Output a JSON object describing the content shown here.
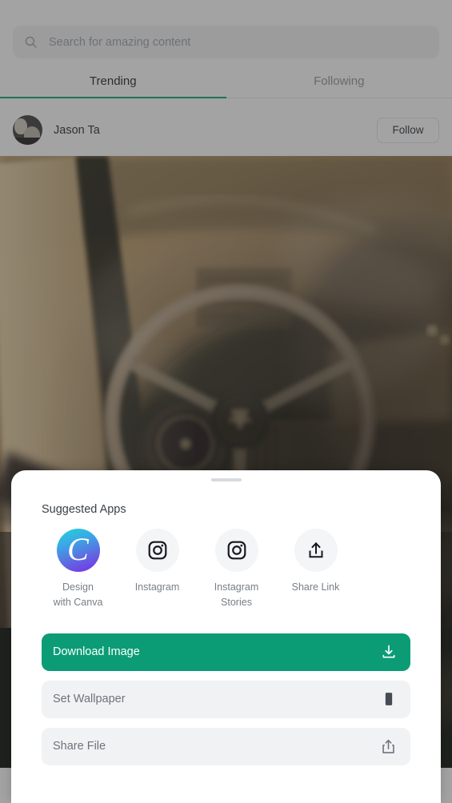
{
  "search": {
    "placeholder": "Search for amazing content",
    "value": "",
    "icon": "search-icon"
  },
  "tabs": [
    {
      "label": "Trending",
      "active": true
    },
    {
      "label": "Following",
      "active": false
    }
  ],
  "post": {
    "author": "Jason Ta",
    "follow_label": "Follow",
    "avatar_icon": "avatar",
    "image_alt": "vintage car interior steering wheel"
  },
  "sheet": {
    "handle": "drag-handle",
    "title": "Suggested Apps",
    "apps": [
      {
        "label": "Design\nwith Canva",
        "label_line1": "Design",
        "label_line2": "with Canva",
        "icon": "canva-icon"
      },
      {
        "label": "Instagram",
        "label_line1": "Instagram",
        "label_line2": "",
        "icon": "instagram-icon"
      },
      {
        "label": "Instagram Stories",
        "label_line1": "Instagram",
        "label_line2": "Stories",
        "icon": "instagram-stories-icon"
      },
      {
        "label": "Share Link",
        "label_line1": "Share Link",
        "label_line2": "",
        "icon": "share-link-icon"
      }
    ],
    "actions": [
      {
        "label": "Download Image",
        "icon": "download-icon",
        "style": "primary"
      },
      {
        "label": "Set Wallpaper",
        "icon": "phone-icon",
        "style": "secondary"
      },
      {
        "label": "Share File",
        "icon": "share-icon",
        "style": "secondary"
      }
    ]
  },
  "colors": {
    "accent_green": "#0b9c76",
    "tab_underline": "#0f9c76",
    "sheet_background": "#ffffff",
    "secondary_button": "#f1f2f4",
    "scrim": "rgba(60,60,60,0.47)"
  }
}
